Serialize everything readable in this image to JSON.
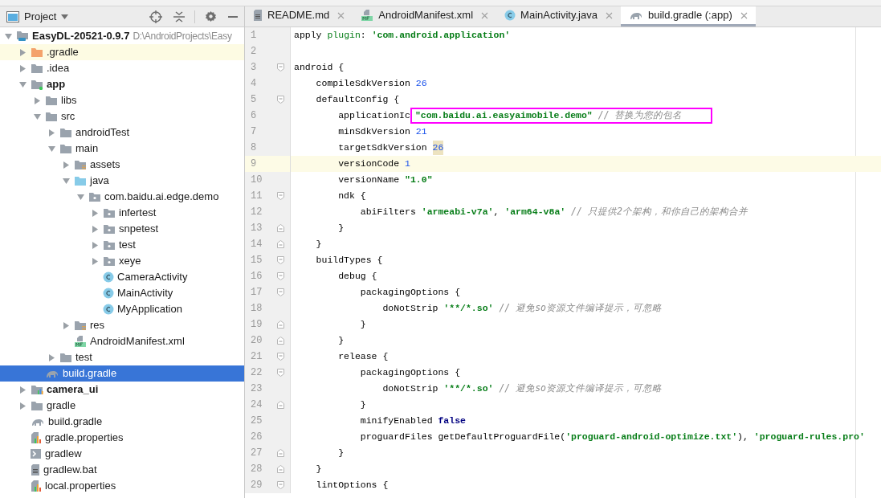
{
  "project_panel": {
    "title": "Project",
    "tree": [
      {
        "label": "EasyDL-20521-0.9.7",
        "hint": "D:\\AndroidProjects\\Easy",
        "kind": "project",
        "bold": true,
        "expanded": true,
        "selected": false,
        "highlighted": false,
        "children": [
          {
            "label": ".gradle",
            "kind": "excluded-folder",
            "expanded": false,
            "selected": false,
            "highlighted": true
          },
          {
            "label": ".idea",
            "kind": "folder",
            "expanded": false,
            "selected": false,
            "highlighted": false
          },
          {
            "label": "app",
            "kind": "module",
            "bold": true,
            "expanded": true,
            "selected": false,
            "highlighted": false,
            "children": [
              {
                "label": "libs",
                "kind": "folder",
                "expanded": false,
                "selected": false,
                "highlighted": false
              },
              {
                "label": "src",
                "kind": "folder",
                "expanded": true,
                "selected": false,
                "highlighted": false,
                "children": [
                  {
                    "label": "androidTest",
                    "kind": "folder",
                    "expanded": false,
                    "selected": false,
                    "highlighted": false
                  },
                  {
                    "label": "main",
                    "kind": "folder",
                    "expanded": true,
                    "selected": false,
                    "highlighted": false,
                    "children": [
                      {
                        "label": "assets",
                        "kind": "resource-folder",
                        "expanded": false,
                        "selected": false,
                        "highlighted": false
                      },
                      {
                        "label": "java",
                        "kind": "source-folder",
                        "expanded": true,
                        "selected": false,
                        "highlighted": false,
                        "children": [
                          {
                            "label": "com.baidu.ai.edge.demo",
                            "kind": "package",
                            "expanded": true,
                            "selected": false,
                            "highlighted": false,
                            "children": [
                              {
                                "label": "infertest",
                                "kind": "package",
                                "expanded": false,
                                "selected": false,
                                "highlighted": false
                              },
                              {
                                "label": "snpetest",
                                "kind": "package",
                                "expanded": false,
                                "selected": false,
                                "highlighted": false
                              },
                              {
                                "label": "test",
                                "kind": "package",
                                "expanded": false,
                                "selected": false,
                                "highlighted": false
                              },
                              {
                                "label": "xeye",
                                "kind": "package",
                                "expanded": false,
                                "selected": false,
                                "highlighted": false
                              },
                              {
                                "label": "CameraActivity",
                                "kind": "class",
                                "selected": false,
                                "highlighted": false
                              },
                              {
                                "label": "MainActivity",
                                "kind": "class",
                                "selected": false,
                                "highlighted": false
                              },
                              {
                                "label": "MyApplication",
                                "kind": "class",
                                "selected": false,
                                "highlighted": false
                              }
                            ]
                          }
                        ]
                      },
                      {
                        "label": "res",
                        "kind": "resource-folder",
                        "expanded": false,
                        "selected": false,
                        "highlighted": false
                      },
                      {
                        "label": "AndroidManifest.xml",
                        "kind": "manifest",
                        "selected": false,
                        "highlighted": false
                      }
                    ]
                  },
                  {
                    "label": "test",
                    "kind": "folder",
                    "expanded": false,
                    "selected": false,
                    "highlighted": false
                  }
                ]
              },
              {
                "label": "build.gradle",
                "kind": "gradle",
                "selected": true,
                "highlighted": false
              }
            ]
          },
          {
            "label": "camera_ui",
            "kind": "lib-module",
            "bold": true,
            "expanded": false,
            "selected": false,
            "highlighted": false
          },
          {
            "label": "gradle",
            "kind": "folder",
            "expanded": false,
            "selected": false,
            "highlighted": false
          },
          {
            "label": "build.gradle",
            "kind": "gradle",
            "selected": false,
            "highlighted": false
          },
          {
            "label": "gradle.properties",
            "kind": "properties",
            "selected": false,
            "highlighted": false
          },
          {
            "label": "gradlew",
            "kind": "script",
            "selected": false,
            "highlighted": false
          },
          {
            "label": "gradlew.bat",
            "kind": "text",
            "selected": false,
            "highlighted": false
          },
          {
            "label": "local.properties",
            "kind": "properties",
            "selected": false,
            "highlighted": false
          }
        ]
      }
    ]
  },
  "editor_tabs": [
    {
      "label": "README.md",
      "kind": "text",
      "selected": false
    },
    {
      "label": "AndroidManifest.xml",
      "kind": "manifest",
      "selected": false
    },
    {
      "label": "MainActivity.java",
      "kind": "class",
      "selected": false
    },
    {
      "label": "build.gradle (:app)",
      "kind": "gradle",
      "selected": true
    }
  ],
  "code_lines": [
    {
      "number": "1",
      "current": false,
      "fold_start": false,
      "fold_end": false,
      "tokens": [
        {
          "kind": "plain",
          "text": "apply "
        },
        {
          "kind": "named",
          "text": "plugin"
        },
        {
          "kind": "plain",
          "text": ": "
        },
        {
          "kind": "string",
          "text": "'com.android.application'"
        }
      ]
    },
    {
      "number": "2",
      "current": false,
      "fold_start": false,
      "fold_end": false
    },
    {
      "number": "3",
      "current": false,
      "fold_start": true,
      "fold_end": false,
      "tokens": [
        {
          "kind": "plain",
          "text": "android {"
        }
      ]
    },
    {
      "number": "4",
      "current": false,
      "fold_start": false,
      "fold_end": false,
      "tokens": [
        {
          "kind": "plain",
          "text": "    compileSdkVersion "
        },
        {
          "kind": "number",
          "text": "26"
        }
      ]
    },
    {
      "number": "5",
      "current": false,
      "fold_start": true,
      "fold_end": false,
      "tokens": [
        {
          "kind": "plain",
          "text": "    defaultConfig {"
        }
      ]
    },
    {
      "number": "6",
      "current": false,
      "fold_start": false,
      "fold_end": false,
      "tokens": [
        {
          "kind": "plain",
          "text": "        applicationIc"
        },
        {
          "kind": "string",
          "text": "\"com.baidu.ai.easyaimobile.demo\"",
          "boxed": true
        },
        {
          "kind": "comment",
          "text": " // 替换为您的包名",
          "boxed": true
        }
      ]
    },
    {
      "number": "7",
      "current": false,
      "fold_start": false,
      "fold_end": false,
      "tokens": [
        {
          "kind": "plain",
          "text": "        minSdkVersion "
        },
        {
          "kind": "number",
          "text": "21"
        }
      ]
    },
    {
      "number": "8",
      "current": false,
      "fold_start": false,
      "fold_end": false,
      "tokens": [
        {
          "kind": "plain",
          "text": "        targetSdkVersion "
        },
        {
          "kind": "number",
          "text": "26",
          "highlighted": true
        }
      ]
    },
    {
      "number": "9",
      "current": true,
      "fold_start": false,
      "fold_end": false,
      "tokens": [
        {
          "kind": "plain",
          "text": "        versionCode "
        },
        {
          "kind": "number",
          "text": "1"
        }
      ]
    },
    {
      "number": "10",
      "current": false,
      "fold_start": false,
      "fold_end": false,
      "tokens": [
        {
          "kind": "plain",
          "text": "        versionName "
        },
        {
          "kind": "string",
          "text": "\"1.0\""
        }
      ]
    },
    {
      "number": "11",
      "current": false,
      "fold_start": true,
      "fold_end": false,
      "tokens": [
        {
          "kind": "plain",
          "text": "        ndk {"
        }
      ]
    },
    {
      "number": "12",
      "current": false,
      "fold_start": false,
      "fold_end": false,
      "tokens": [
        {
          "kind": "plain",
          "text": "            abiFilters "
        },
        {
          "kind": "string",
          "text": "'armeabi-v7a'"
        },
        {
          "kind": "plain",
          "text": ", "
        },
        {
          "kind": "string",
          "text": "'arm64-v8a'"
        },
        {
          "kind": "comment",
          "text": " // 只提供2个架构，和你自己的架构合并"
        }
      ]
    },
    {
      "number": "13",
      "current": false,
      "fold_start": false,
      "fold_end": true,
      "tokens": [
        {
          "kind": "plain",
          "text": "        }"
        }
      ]
    },
    {
      "number": "14",
      "current": false,
      "fold_start": false,
      "fold_end": true,
      "tokens": [
        {
          "kind": "plain",
          "text": "    }"
        }
      ]
    },
    {
      "number": "15",
      "current": false,
      "fold_start": true,
      "fold_end": false,
      "tokens": [
        {
          "kind": "plain",
          "text": "    buildTypes {"
        }
      ]
    },
    {
      "number": "16",
      "current": false,
      "fold_start": true,
      "fold_end": false,
      "tokens": [
        {
          "kind": "plain",
          "text": "        debug {"
        }
      ]
    },
    {
      "number": "17",
      "current": false,
      "fold_start": true,
      "fold_end": false,
      "tokens": [
        {
          "kind": "plain",
          "text": "            packagingOptions {"
        }
      ]
    },
    {
      "number": "18",
      "current": false,
      "fold_start": false,
      "fold_end": false,
      "tokens": [
        {
          "kind": "plain",
          "text": "                doNotStrip "
        },
        {
          "kind": "string",
          "text": "'**/*.so'"
        },
        {
          "kind": "comment",
          "text": " // 避免so资源文件编译提示，可忽略"
        }
      ]
    },
    {
      "number": "19",
      "current": false,
      "fold_start": false,
      "fold_end": true,
      "tokens": [
        {
          "kind": "plain",
          "text": "            }"
        }
      ]
    },
    {
      "number": "20",
      "current": false,
      "fold_start": false,
      "fold_end": true,
      "tokens": [
        {
          "kind": "plain",
          "text": "        }"
        }
      ]
    },
    {
      "number": "21",
      "current": false,
      "fold_start": true,
      "fold_end": false,
      "tokens": [
        {
          "kind": "plain",
          "text": "        release {"
        }
      ]
    },
    {
      "number": "22",
      "current": false,
      "fold_start": true,
      "fold_end": false,
      "tokens": [
        {
          "kind": "plain",
          "text": "            packagingOptions {"
        }
      ]
    },
    {
      "number": "23",
      "current": false,
      "fold_start": false,
      "fold_end": false,
      "tokens": [
        {
          "kind": "plain",
          "text": "                doNotStrip "
        },
        {
          "kind": "string",
          "text": "'**/*.so'"
        },
        {
          "kind": "comment",
          "text": " // 避免so资源文件编译提示，可忽略"
        }
      ]
    },
    {
      "number": "24",
      "current": false,
      "fold_start": false,
      "fold_end": true,
      "tokens": [
        {
          "kind": "plain",
          "text": "            }"
        }
      ]
    },
    {
      "number": "25",
      "current": false,
      "fold_start": false,
      "fold_end": false,
      "tokens": [
        {
          "kind": "plain",
          "text": "            minifyEnabled "
        },
        {
          "kind": "keyword",
          "text": "false"
        }
      ]
    },
    {
      "number": "26",
      "current": false,
      "fold_start": false,
      "fold_end": false,
      "tokens": [
        {
          "kind": "plain",
          "text": "            proguardFiles getDefaultProguardFile("
        },
        {
          "kind": "string",
          "text": "'proguard-android-optimize.txt'"
        },
        {
          "kind": "plain",
          "text": "), "
        },
        {
          "kind": "string",
          "text": "'proguard-rules.pro'"
        }
      ]
    },
    {
      "number": "27",
      "current": false,
      "fold_start": false,
      "fold_end": true,
      "tokens": [
        {
          "kind": "plain",
          "text": "        }"
        }
      ]
    },
    {
      "number": "28",
      "current": false,
      "fold_start": false,
      "fold_end": true,
      "tokens": [
        {
          "kind": "plain",
          "text": "    }"
        }
      ]
    },
    {
      "number": "29",
      "current": false,
      "fold_start": true,
      "fold_end": false,
      "tokens": [
        {
          "kind": "plain",
          "text": "    lintOptions {"
        }
      ]
    }
  ]
}
